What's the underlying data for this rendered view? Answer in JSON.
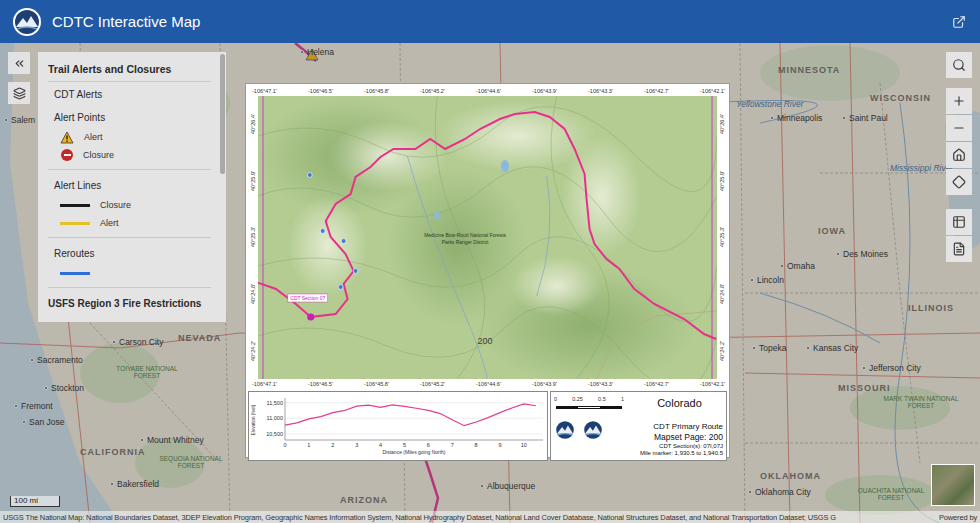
{
  "header": {
    "title": "CDTC Interactive Map"
  },
  "panel": {
    "title": "Trail Alerts and Closures",
    "group": "CDT Alerts",
    "sections": [
      {
        "title": "Alert Points",
        "items": [
          {
            "label": "Alert",
            "kind": "warning",
            "color": "#f1b320"
          },
          {
            "label": "Closure",
            "kind": "stop",
            "color": "#c62828"
          }
        ]
      },
      {
        "title": "Alert Lines",
        "items": [
          {
            "label": "Closure",
            "kind": "line",
            "color": "#1a1a1a"
          },
          {
            "label": "Alert",
            "kind": "line",
            "color": "#e6c229"
          }
        ]
      },
      {
        "title": "Reroutes",
        "items": [
          {
            "kind": "line",
            "color": "#2d6fd8"
          }
        ]
      }
    ],
    "footer": "USFS Region 3 Fire Restrictions"
  },
  "basemap": {
    "labels": [
      {
        "text": "Helena",
        "kind": "city"
      },
      {
        "text": "Yellowstone River",
        "kind": "water"
      },
      {
        "text": "MINNESOTA",
        "kind": "state"
      },
      {
        "text": "WISCONSIN",
        "kind": "state"
      },
      {
        "text": "Minneapolis",
        "kind": "city"
      },
      {
        "text": "Saint Paul",
        "kind": "city"
      },
      {
        "text": "Mississippi River",
        "kind": "water"
      },
      {
        "text": "Salem",
        "kind": "city"
      },
      {
        "text": "IOWA",
        "kind": "state"
      },
      {
        "text": "Des Moines",
        "kind": "city"
      },
      {
        "text": "Omaha",
        "kind": "city"
      },
      {
        "text": "Lincoln",
        "kind": "city"
      },
      {
        "text": "ILLINOIS",
        "kind": "state"
      },
      {
        "text": "Topeka",
        "kind": "city"
      },
      {
        "text": "Kansas City",
        "kind": "city"
      },
      {
        "text": "Jefferson City",
        "kind": "city"
      },
      {
        "text": "MISSOURI",
        "kind": "state"
      },
      {
        "text": "MARK TWAIN NATIONAL FOREST",
        "kind": "forest"
      },
      {
        "text": "Carson City",
        "kind": "city"
      },
      {
        "text": "NEVADA",
        "kind": "state"
      },
      {
        "text": "Sacramento",
        "kind": "city"
      },
      {
        "text": "Stockton",
        "kind": "city"
      },
      {
        "text": "Fremont",
        "kind": "city"
      },
      {
        "text": "San Jose",
        "kind": "city"
      },
      {
        "text": "TOIYABE NATIONAL FOREST",
        "kind": "forest"
      },
      {
        "text": "CALIFORNIA",
        "kind": "state"
      },
      {
        "text": "Mount Whitney",
        "kind": "city"
      },
      {
        "text": "SEQUOIA NATIONAL FOREST",
        "kind": "forest"
      },
      {
        "text": "Bakersfield",
        "kind": "city"
      },
      {
        "text": "ARIZONA",
        "kind": "state"
      },
      {
        "text": "Albuquerque",
        "kind": "city"
      },
      {
        "text": "OKLAHOMA",
        "kind": "state"
      },
      {
        "text": "Oklahoma City",
        "kind": "city"
      },
      {
        "text": "OUACHITA NATIONAL FOREST",
        "kind": "forest"
      }
    ],
    "scale": "100 mi",
    "attribution": "USGS The National Map: National Boundaries Dataset, 3DEP Elevation Program, Geographic Names Information System, National Hydrography Dataset, National Land Cover Database, National Structures Dataset, and National Transportation Dataset; USGS G",
    "powered_by": "Powered by"
  },
  "map_page": {
    "lon_ticks": [
      "-106°47.1'",
      "-106°46.5'",
      "-106°45.8'",
      "-106°45.2'",
      "-106°44.6'",
      "-106°43.9'",
      "-106°43.3'",
      "-106°42.7'",
      "-106°42.1'"
    ],
    "lat_ticks": [
      "40°26.4'",
      "40°25.9'",
      "40°25.3'",
      "40°24.8'",
      "40°24.2'"
    ],
    "forest": "Medicine Bow-Routt National Forests",
    "district": "Parks Ranger District",
    "page_number": "200",
    "section_label": "CDT Section 07",
    "profile": {
      "y_label": "Elevation (feet)",
      "x_label": "Distance (Miles going North)",
      "y_ticks": [
        "11,500",
        "11,000",
        "10,500"
      ],
      "x_ticks": [
        "0",
        "1",
        "2",
        "3",
        "4",
        "5",
        "6",
        "7",
        "8",
        "9",
        "10"
      ],
      "distances": [
        0,
        0.5,
        1,
        1.5,
        2,
        2.5,
        3,
        3.5,
        4,
        4.5,
        5,
        5.5,
        6,
        6.5,
        7,
        7.5,
        8,
        8.5,
        9,
        9.5,
        10,
        10.5
      ],
      "elevations": [
        10780,
        10850,
        10980,
        11050,
        11180,
        11250,
        11390,
        11420,
        11350,
        11430,
        11380,
        11320,
        11250,
        11150,
        10950,
        10760,
        10880,
        11020,
        11180,
        11330,
        11460,
        11400
      ]
    },
    "info": {
      "state": "Colorado",
      "route": "CDT Primary Route",
      "page": "Mapset Page: 200",
      "sections": "CDT Section(s): 07I,07J",
      "miles": "Mile marker: 1,930.5 to 1,940.5",
      "scale": [
        "0",
        "0.25",
        "0.5",
        "1"
      ]
    }
  }
}
